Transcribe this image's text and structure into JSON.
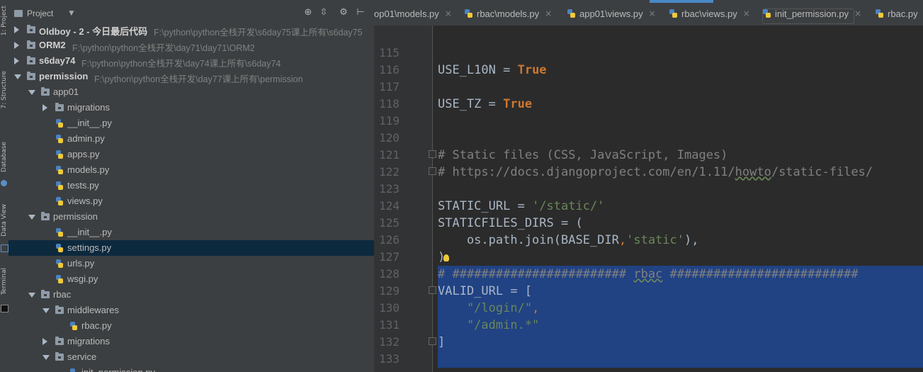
{
  "toolstrip": {
    "tabs": [
      "1: Project",
      "7: Structure",
      "Database",
      "Data View",
      "Terminal"
    ]
  },
  "project_panel": {
    "title": "Project",
    "header_icons": [
      "crosshair-icon",
      "collapse-icon",
      "gear-icon",
      "hide-icon"
    ],
    "tree": [
      {
        "label": "Oldboy - 2 - 今日最后代码",
        "path": "F:\\python\\python全栈开发\\s6day75课上所有\\s6day75",
        "type": "folder",
        "expanded": false,
        "bold": true
      },
      {
        "label": "ORM2",
        "path": "F:\\python\\python全栈开发\\day71\\day71\\ORM2",
        "type": "folder",
        "expanded": false,
        "bold": true
      },
      {
        "label": "s6day74",
        "path": "F:\\python\\python全栈开发\\day74课上所有\\s6day74",
        "type": "folder",
        "expanded": false,
        "bold": true
      },
      {
        "label": "permission",
        "path": "F:\\python\\python全栈开发\\day77课上所有\\permission",
        "type": "folder",
        "expanded": true,
        "bold": true
      },
      {
        "label": "app01",
        "type": "folder",
        "expanded": true
      },
      {
        "label": "migrations",
        "type": "folder",
        "expanded": false
      },
      {
        "label": "__init__.py",
        "type": "py"
      },
      {
        "label": "admin.py",
        "type": "py"
      },
      {
        "label": "apps.py",
        "type": "py"
      },
      {
        "label": "models.py",
        "type": "py"
      },
      {
        "label": "tests.py",
        "type": "py"
      },
      {
        "label": "views.py",
        "type": "py"
      },
      {
        "label": "permission",
        "type": "folder",
        "expanded": true
      },
      {
        "label": "__init__.py",
        "type": "py"
      },
      {
        "label": "settings.py",
        "type": "py",
        "selected": true
      },
      {
        "label": "urls.py",
        "type": "py"
      },
      {
        "label": "wsgi.py",
        "type": "py"
      },
      {
        "label": "rbac",
        "type": "folder",
        "expanded": true
      },
      {
        "label": "middlewares",
        "type": "folder",
        "expanded": true
      },
      {
        "label": "rbac.py",
        "type": "py"
      },
      {
        "label": "migrations",
        "type": "folder",
        "expanded": false
      },
      {
        "label": "service",
        "type": "folder",
        "expanded": true
      },
      {
        "label": "init_permission.py",
        "type": "py"
      }
    ]
  },
  "tabs": [
    {
      "label": "op01\\models.py"
    },
    {
      "label": "rbac\\models.py"
    },
    {
      "label": "app01\\views.py"
    },
    {
      "label": "rbac\\views.py"
    },
    {
      "label": "init_permission.py"
    },
    {
      "label": "rbac.py"
    }
  ],
  "tab_close_glyph": "×",
  "editor": {
    "line_numbers": [
      "115",
      "116",
      "117",
      "118",
      "119",
      "120",
      "121",
      "122",
      "123",
      "124",
      "125",
      "126",
      "127",
      "128",
      "129",
      "130",
      "131",
      "132",
      "133"
    ],
    "code": {
      "l116a": "USE_L10N = ",
      "l116b": "True",
      "l118a": "USE_TZ = ",
      "l118b": "True",
      "l121": "# Static files (CSS, JavaScript, Images)",
      "l122a": "# https://docs.djangoproject.com/en/1.11/",
      "l122b": "howto",
      "l122c": "/static-files/",
      "l124a": "STATIC_URL = ",
      "l124b": "'/static/'",
      "l125": "STATICFILES_DIRS = (",
      "l126a": "    os.path.join(BASE_DIR",
      "l126b": ",",
      "l126c": "'static'",
      "l126d": "),",
      "l127": ")",
      "l128a": "# ######################## ",
      "l128b": "rbac",
      "l128c": " ##########################",
      "l129": "VALID_URL = [",
      "l130a": "    \"/login/\"",
      "l130b": ",",
      "l131": "    \"/admin.*\"",
      "l132": "]"
    }
  },
  "colors": {
    "selection": "#214283",
    "keyword": "#cc7832",
    "string": "#6a8759",
    "comment": "#808080",
    "selected_row": "#0d293e"
  }
}
